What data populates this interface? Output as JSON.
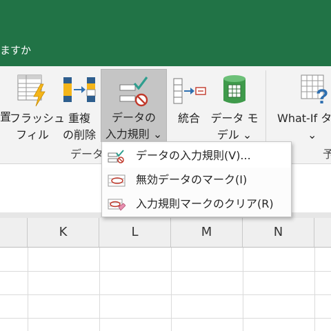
{
  "titlebar": {
    "text": "ますか"
  },
  "ribbon": {
    "partial_label_top": "置",
    "buttons": [
      {
        "id": "flash-fill",
        "line1": "フラッシュ",
        "line2": "フィル"
      },
      {
        "id": "remove-duplicates",
        "line1": "重複",
        "line2": "の削除"
      },
      {
        "id": "data-validation",
        "line1": "データの",
        "line2": "入力規則 ⌄"
      },
      {
        "id": "consolidate",
        "line1": "統合",
        "line2": ""
      },
      {
        "id": "data-model",
        "line1": "データ モ",
        "line2": "デル ⌄"
      },
      {
        "id": "what-if",
        "line1": "What-If タ",
        "line2": "⌄"
      }
    ],
    "group_label_data": "データ",
    "group_label_forecast": "予"
  },
  "dropdown": {
    "items": [
      {
        "label": "データの入力規則(V)...",
        "icon": "data-validation-icon"
      },
      {
        "label": "無効データのマーク(I)",
        "icon": "circle-invalid-icon"
      },
      {
        "label": "入力規則マークのクリア(R)",
        "icon": "clear-circles-icon"
      }
    ]
  },
  "columns": [
    "K",
    "L",
    "M",
    "N"
  ],
  "colors": {
    "excel_green": "#217346",
    "ribbon_bg": "#f3f3f3",
    "pressed": "#c5c5c5",
    "red": "#c0392b",
    "teal_check": "#2e9e8e"
  }
}
